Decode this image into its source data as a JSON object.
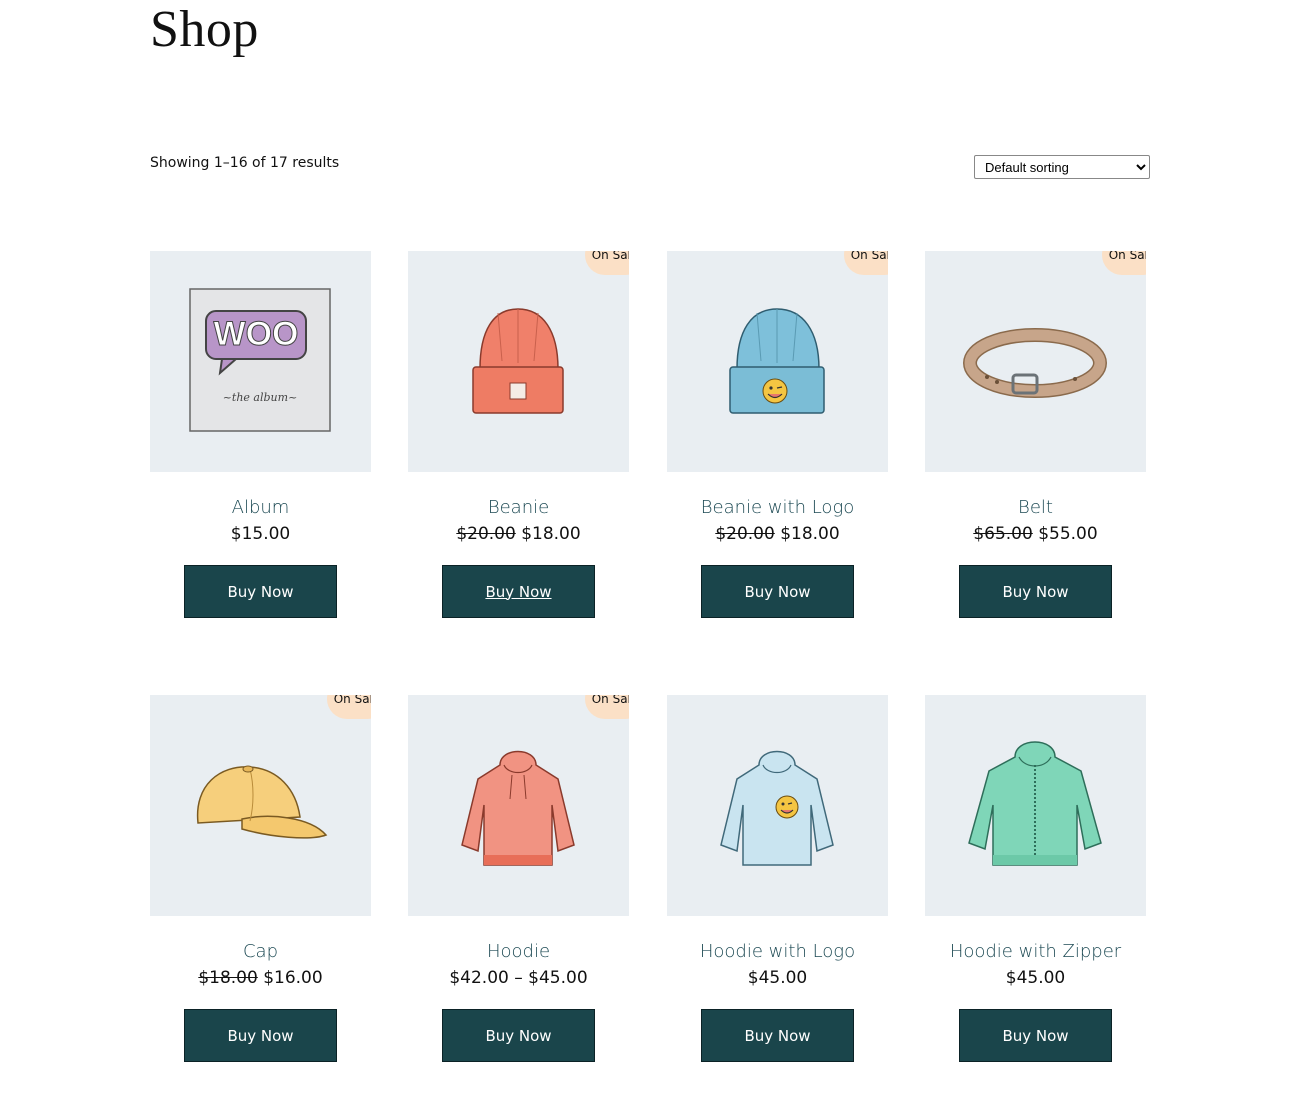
{
  "page": {
    "title": "Shop"
  },
  "toolbar": {
    "result_count": "Showing 1–16 of 17 results",
    "sort_selected": "Default sorting"
  },
  "sale_badge": "On Sale",
  "products": [
    {
      "title": "Album",
      "regular": "",
      "price": "$15.00",
      "on_sale": false,
      "button": "Buy Now",
      "icon": "album-icon"
    },
    {
      "title": "Beanie",
      "regular": "$20.00",
      "price": "$18.00",
      "on_sale": true,
      "button": "Buy Now",
      "icon": "beanie-icon"
    },
    {
      "title": "Beanie with Logo",
      "regular": "$20.00",
      "price": "$18.00",
      "on_sale": true,
      "button": "Buy Now",
      "icon": "beanie-logo-icon"
    },
    {
      "title": "Belt",
      "regular": "$65.00",
      "price": "$55.00",
      "on_sale": true,
      "button": "Buy Now",
      "icon": "belt-icon"
    },
    {
      "title": "Cap",
      "regular": "$18.00",
      "price": "$16.00",
      "on_sale": true,
      "button": "Buy Now",
      "icon": "cap-icon"
    },
    {
      "title": "Hoodie",
      "regular": "",
      "price": "$42.00 – $45.00",
      "on_sale": true,
      "button": "Buy Now",
      "icon": "hoodie-icon"
    },
    {
      "title": "Hoodie with Logo",
      "regular": "",
      "price": "$45.00",
      "on_sale": false,
      "button": "Buy Now",
      "icon": "hoodie-logo-icon"
    },
    {
      "title": "Hoodie with Zipper",
      "regular": "",
      "price": "$45.00",
      "on_sale": false,
      "button": "Buy Now",
      "icon": "hoodie-zipper-icon"
    }
  ]
}
